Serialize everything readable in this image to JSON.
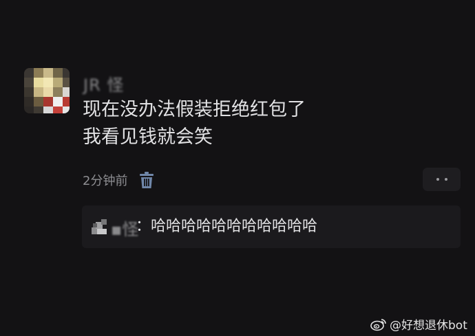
{
  "comment": {
    "username": "JR 怪",
    "message_lines": [
      "现在没办法假装拒绝红包了",
      "我看见钱就会笑"
    ],
    "timestamp": "2分钟前",
    "delete_icon": "trash-icon",
    "more_icon": "more-dots-icon"
  },
  "reply": {
    "name": "▪怪",
    "text": "：哈哈哈哈哈哈哈哈哈哈哈"
  },
  "watermark": {
    "icon": "weibo-icon",
    "text": "@好想退休bot"
  },
  "colors": {
    "background": "#131214",
    "reply_background": "#1b1a1d",
    "primary_text": "#e2e2e4",
    "secondary_text": "#8e8e92",
    "delete_icon": "#6f86a8"
  }
}
